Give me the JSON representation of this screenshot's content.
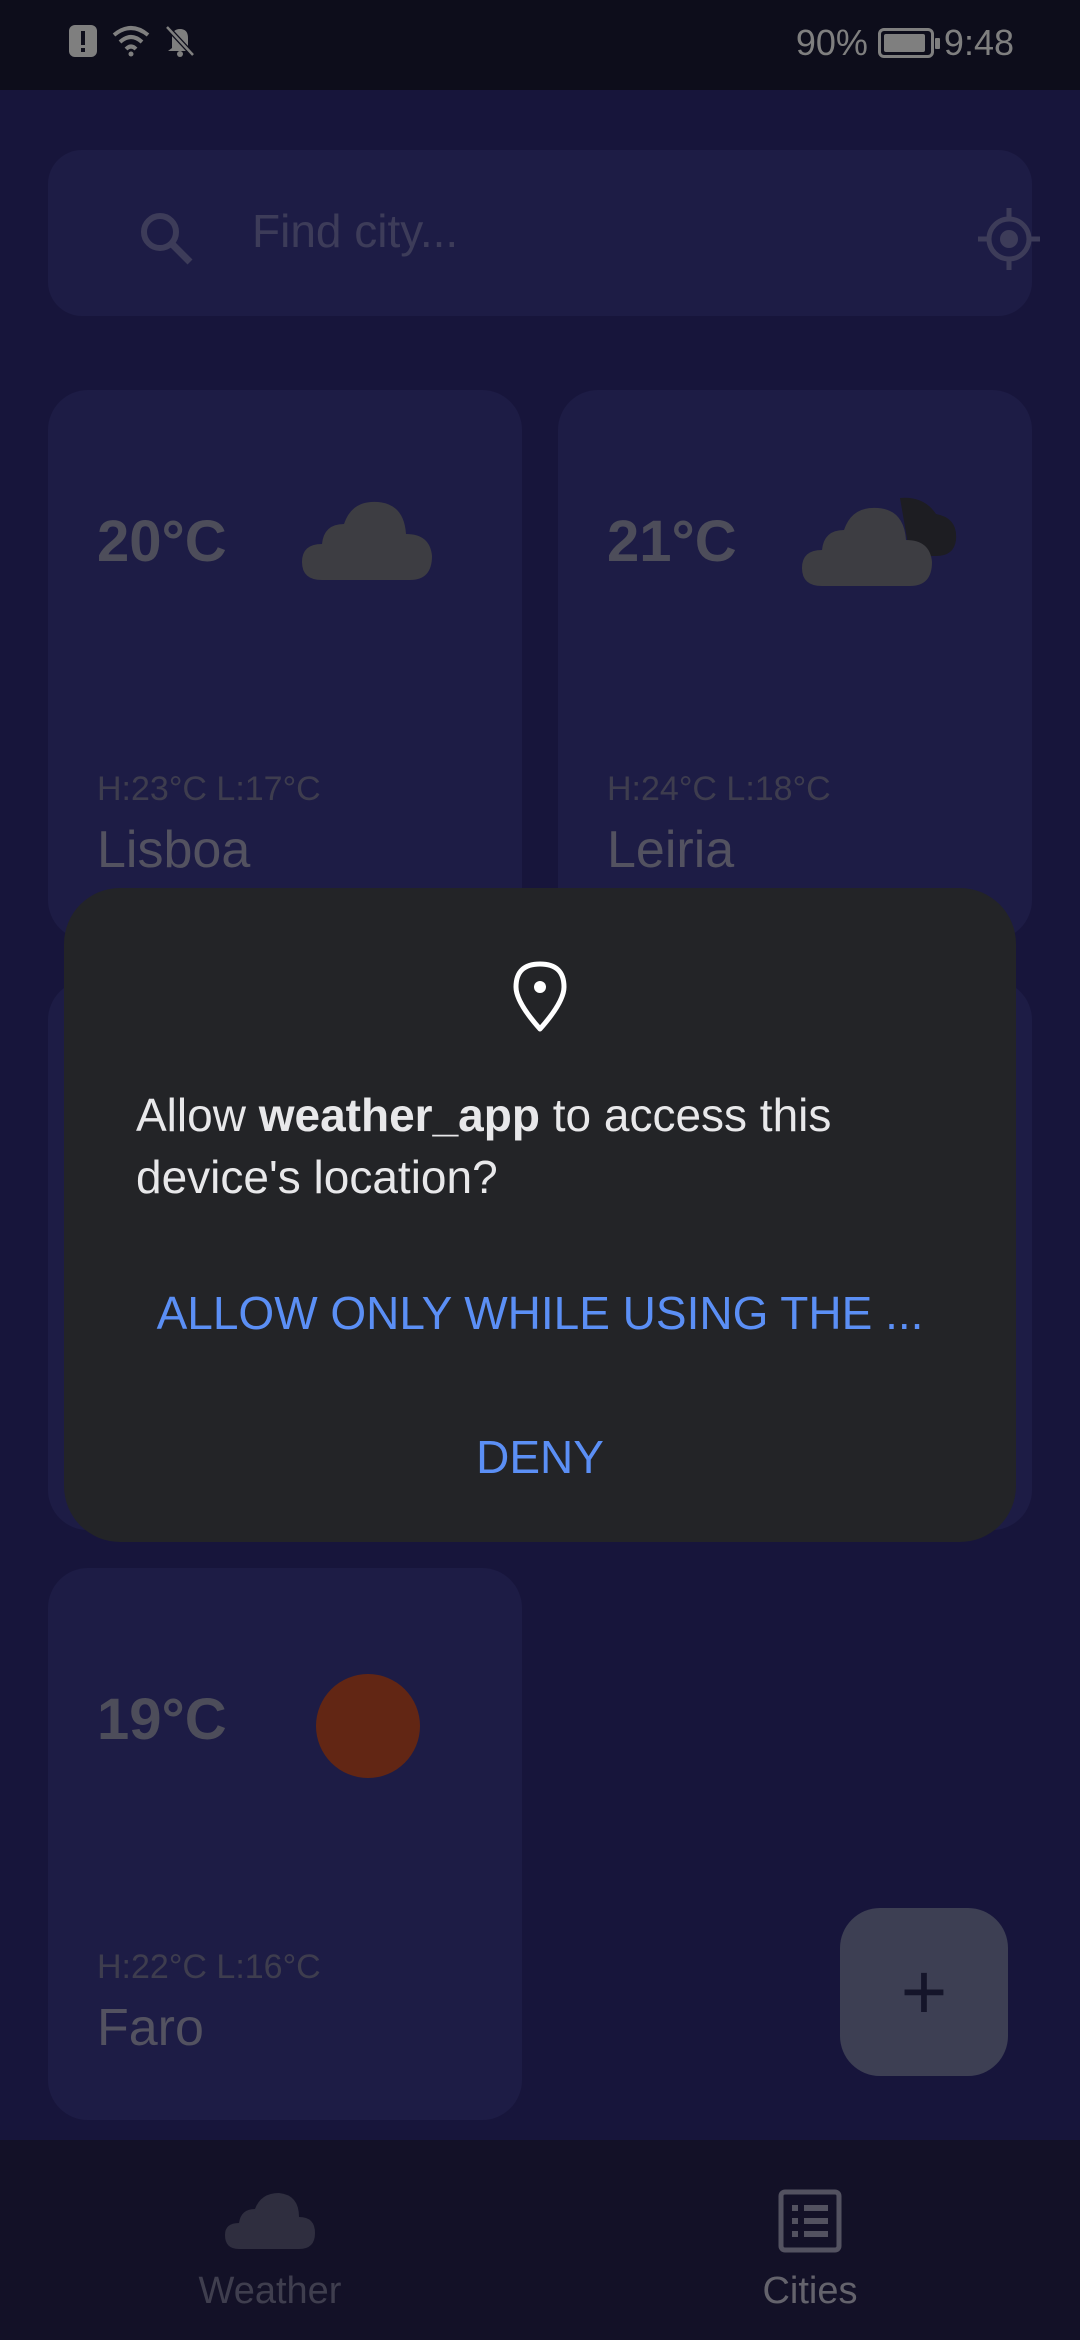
{
  "status_bar": {
    "battery_percent": "90%",
    "time": "9:48",
    "icons": [
      "alert-icon",
      "wifi-icon",
      "bell-off-icon",
      "battery-charging-icon"
    ]
  },
  "search": {
    "placeholder": "Find city...",
    "icons": [
      "search-icon",
      "locate-icon"
    ]
  },
  "cities": [
    {
      "temp": "20°C",
      "high_low": "H:23°C  L:17°C",
      "name": "Lisboa",
      "icon": "cloud-icon"
    },
    {
      "temp": "21°C",
      "high_low": "H:24°C  L:18°C",
      "name": "Leiria",
      "icon": "cloud-night-icon"
    },
    {
      "temp": "19°C",
      "high_low": "H:22°C  L:16°C",
      "name": "Faro",
      "icon": "sun-icon"
    }
  ],
  "fab": {
    "label": "+",
    "icon": "plus-icon"
  },
  "bottom_nav": {
    "items": [
      {
        "label": "Weather",
        "icon": "cloud-icon",
        "active": false
      },
      {
        "label": "Cities",
        "icon": "list-icon",
        "active": true
      }
    ]
  },
  "dialog": {
    "prefix": "Allow ",
    "app_name": "weather_app",
    "suffix": " to access this device's location?",
    "allow_label": "ALLOW ONLY WHILE USING THE ...",
    "deny_label": "DENY",
    "icon": "location-pin-icon"
  },
  "colors": {
    "background": "#2f2b77",
    "card": "#3b388a",
    "dialog": "#232427",
    "accent": "#5b8ff5"
  }
}
